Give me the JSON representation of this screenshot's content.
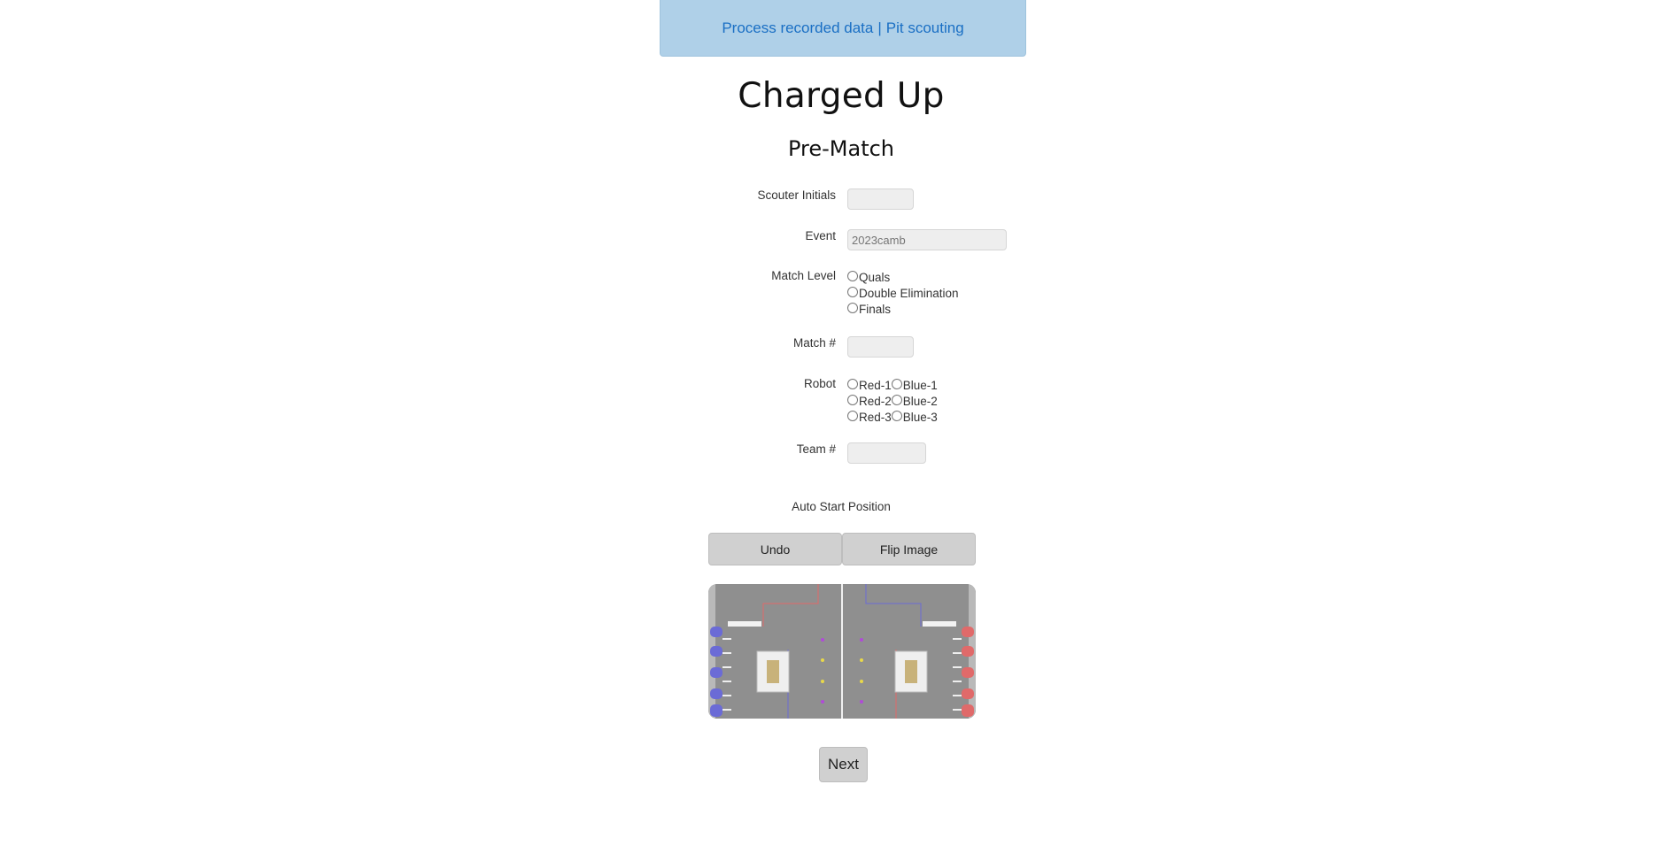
{
  "nav": {
    "process_link": "Process recorded data",
    "separator": "|",
    "pit_link": "Pit scouting"
  },
  "page": {
    "title": "Charged Up",
    "section": "Pre-Match"
  },
  "form": {
    "scouter_initials": {
      "label": "Scouter Initials",
      "value": ""
    },
    "event": {
      "label": "Event",
      "value": "",
      "placeholder": "2023camb"
    },
    "match_level": {
      "label": "Match Level",
      "options": [
        "Quals",
        "Double Elimination",
        "Finals"
      ]
    },
    "match_number": {
      "label": "Match #",
      "value": ""
    },
    "robot": {
      "label": "Robot",
      "red": [
        "Red-1",
        "Red-2",
        "Red-3"
      ],
      "blue": [
        "Blue-1",
        "Blue-2",
        "Blue-3"
      ]
    },
    "team_number": {
      "label": "Team #",
      "value": ""
    }
  },
  "auto": {
    "label": "Auto Start Position",
    "undo_label": "Undo",
    "flip_label": "Flip Image",
    "field_colors": {
      "floor": "#8f8f8f",
      "blue": "#6b6bd6",
      "red": "#e06a6a"
    }
  },
  "next_label": "Next"
}
